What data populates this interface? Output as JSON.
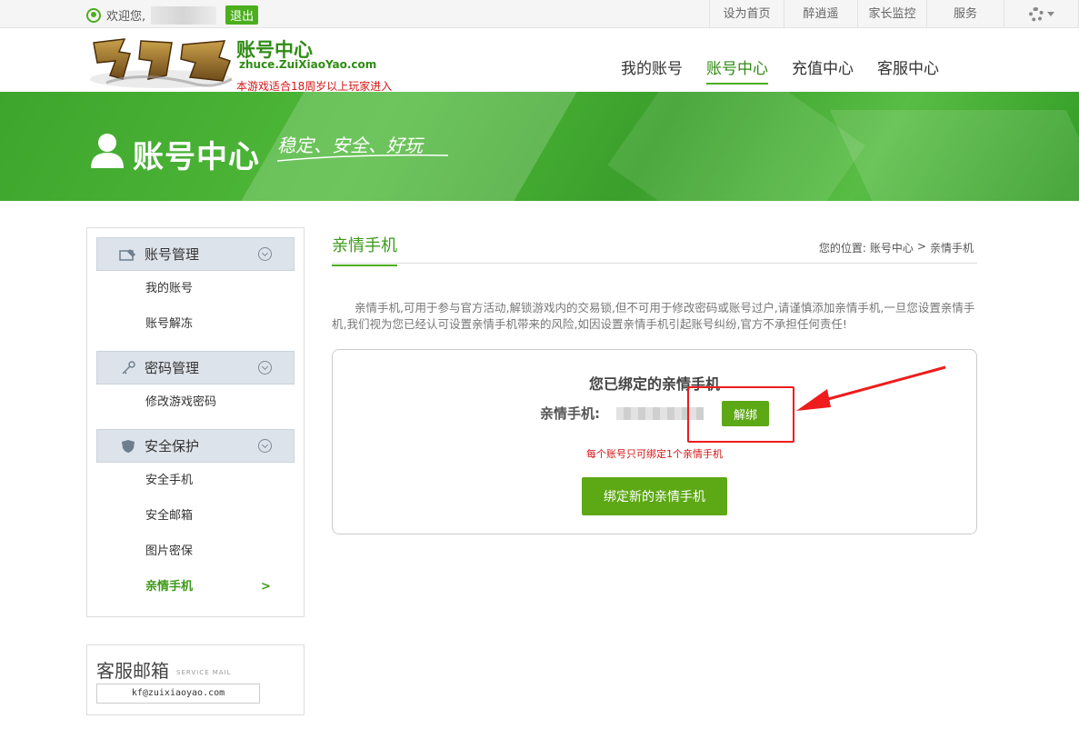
{
  "topbar": {
    "welcome_text": "欢迎您,",
    "logout_label": "退出",
    "links": [
      "设为首页",
      "醉逍遥",
      "家长监控",
      "服务"
    ]
  },
  "header": {
    "logo_title": "账号中心",
    "logo_url": "zhuce.ZuiXiaoYao.com",
    "age_note": "本游戏适合18周岁以上玩家进入",
    "nav": [
      {
        "label": "我的账号",
        "active": false
      },
      {
        "label": "账号中心",
        "active": true
      },
      {
        "label": "充值中心",
        "active": false
      },
      {
        "label": "客服中心",
        "active": false
      }
    ]
  },
  "banner": {
    "title": "账号中心",
    "slogan": "稳定、安全、好玩"
  },
  "sidebar": {
    "groups": [
      {
        "label": "账号管理",
        "icon": "id-card-icon",
        "items": [
          {
            "label": "我的账号"
          },
          {
            "label": "账号解冻"
          }
        ]
      },
      {
        "label": "密码管理",
        "icon": "key-icon",
        "items": [
          {
            "label": "修改游戏密码"
          }
        ]
      },
      {
        "label": "安全保护",
        "icon": "shield-icon",
        "items": [
          {
            "label": "安全手机"
          },
          {
            "label": "安全邮箱"
          },
          {
            "label": "图片密保"
          },
          {
            "label": "亲情手机",
            "active": true,
            "arrow": ">"
          }
        ]
      }
    ]
  },
  "service_mail": {
    "title": "客服邮箱",
    "subtitle": "SERVICE MAIL",
    "email": "kf@zuixiaoyao.com"
  },
  "content": {
    "title": "亲情手机",
    "breadcrumb": {
      "prefix": "您的位置:",
      "parent": "账号中心",
      "separator": ">",
      "current": "亲情手机"
    },
    "notice": "亲情手机,可用于参与官方活动,解锁游戏内的交易锁,但不可用于修改密码或账号过户,请谨慎添加亲情手机,一旦您设置亲情手机,我们视为您已经认可设置亲情手机带来的风险,如因设置亲情手机引起账号纠纷,官方不承担任何责任!",
    "bound_title": "您已绑定的亲情手机",
    "phone_label": "亲情手机:",
    "unbind_label": "解绑",
    "bind_note": "每个账号只可绑定1个亲情手机",
    "bind_new_label": "绑定新的亲情手机"
  },
  "colors": {
    "accent": "#4cae1d",
    "button": "#5da815",
    "warning": "#d31515",
    "annotation": "#ee1c1c"
  }
}
